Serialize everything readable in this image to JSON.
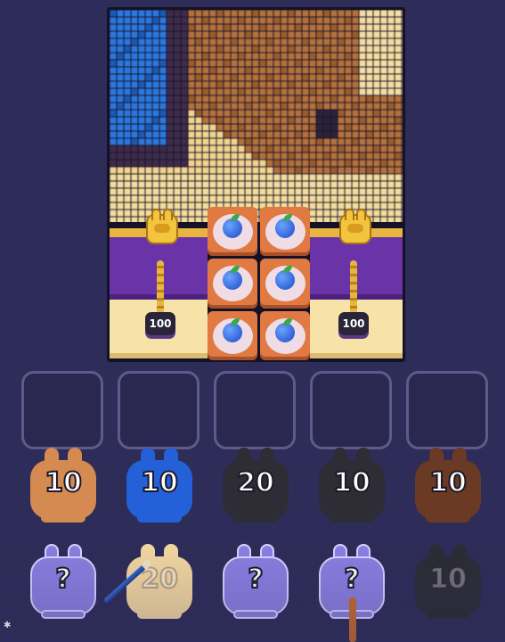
{
  "gate_left": {
    "count": "100"
  },
  "gate_right": {
    "count": "100"
  },
  "food_tiles": [
    "blueberry-plate",
    "blueberry-plate",
    "blueberry-plate",
    "blueberry-plate",
    "blueberry-plate",
    "blueberry-plate"
  ],
  "slots": [
    "",
    "",
    "",
    "",
    ""
  ],
  "bunnies_front": [
    {
      "color": "#d48a50",
      "label": "10"
    },
    {
      "color": "#2460d8",
      "label": "10"
    },
    {
      "color": "#2e2c34",
      "label": "20"
    },
    {
      "color": "#2e2c34",
      "label": "10"
    },
    {
      "color": "#6a3a24",
      "label": "10"
    }
  ],
  "bunnies_back": [
    {
      "color": "#8a7ee0",
      "label": "?"
    },
    {
      "color": "#f2d6a0",
      "label": "20"
    },
    {
      "color": "#8a7ee0",
      "label": "?"
    },
    {
      "color": "#8a7ee0",
      "label": "?"
    },
    {
      "color": "#2c2c30",
      "label": "10"
    }
  ],
  "colors": {
    "background": "#2e2c58",
    "board_frame": "#151228",
    "slot_border": "#5e5b8a"
  }
}
